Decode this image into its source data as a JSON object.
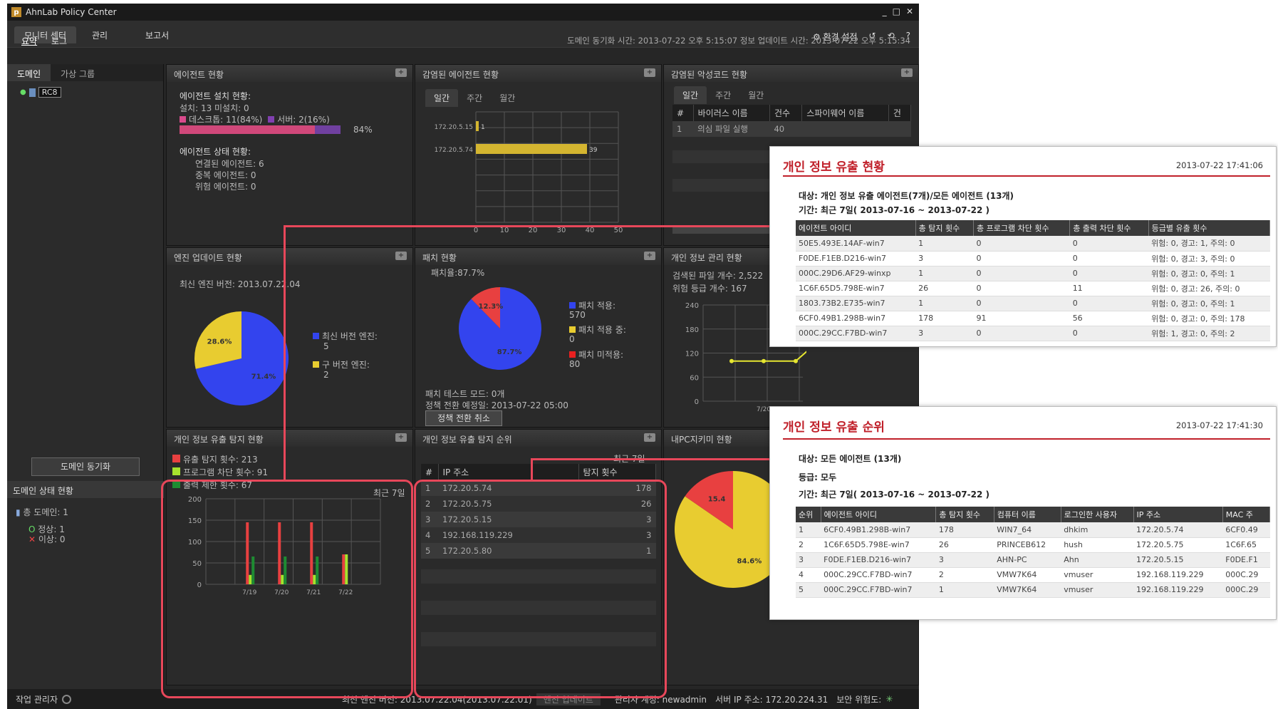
{
  "app": {
    "title": "AhnLab Policy Center",
    "logo_letter": "p",
    "win_controls": [
      "_",
      "□",
      "✕"
    ],
    "menu": [
      "모니터 센터",
      "관리",
      "보고서"
    ],
    "subtabs": [
      "요약",
      "로그"
    ],
    "settings_label": "환경 설정",
    "help_label": "?",
    "sync_time": "도메인 동기화 시간: 2013-07-22 오후 5:15:07   정보 업데이트 시간: 2013-07-22 오후 5:15:34"
  },
  "left": {
    "tabs": [
      "도메인",
      "가상 그룹"
    ],
    "tree_node": "RC8",
    "sync_button": "도메인 동기화",
    "status_title": "도메인 상태 현황",
    "total_domains": "총 도메인: 1",
    "normal": "정상: 1",
    "abnormal": "이상: 0"
  },
  "agent_panel": {
    "title": "에이전트 현황",
    "install_title": "에이전트 설치 현황:",
    "install_counts": "설치: 13   미설치: 0",
    "desktop": "데스크톱: 11(84%)",
    "server": "서버: 2(16%)",
    "install_pct": "84%",
    "install_fraction": 0.84,
    "state_title": "에이전트 상태 현황:",
    "connected": "연결된 에이전트: 6",
    "duplicate": "중복 에이전트: 0",
    "risk": "위험 에이전트: 0"
  },
  "infected_agent_panel": {
    "title": "감염된 에이전트 현황",
    "tabs": [
      "일간",
      "주간",
      "월간"
    ]
  },
  "malware_panel": {
    "title": "감염된 악성코드 현황",
    "tabs": [
      "일간",
      "주간",
      "월간"
    ],
    "columns": [
      "#",
      "바이러스 이름",
      "건수",
      "스파이웨어 이름",
      "건"
    ],
    "row": [
      "1",
      "의심 파일 실행",
      "40"
    ]
  },
  "engine_panel": {
    "title": "엔진 업데이트 현황",
    "latest": "최신 엔진 버전: 2013.07.22.04",
    "legend_latest": "최신 버전 엔진:",
    "legend_latest_count": "5",
    "legend_old": "구 버전 엔진:",
    "legend_old_count": "2",
    "label_new": "71.4%",
    "label_old": "28.6%"
  },
  "patch_panel": {
    "title": "패치 현황",
    "rate": "패치율:87.7%",
    "legend_applied": "패치 적용:",
    "legend_applied_count": "570",
    "legend_applying": "패치 적용 중:",
    "legend_applying_count": "0",
    "legend_unapplied": "패치 미적용:",
    "legend_unapplied_count": "80",
    "label_applied": "87.7%",
    "label_unapplied": "12.3%",
    "test_mode": "패치 테스트 모드: 0개",
    "policy_switch": "정책 전환 예정일: 2013-07-22 05:00",
    "cancel_button": "정책 전환 취소"
  },
  "privacy_mgmt_panel": {
    "title": "개인 정보 관리 현황",
    "files": "검색된 파일 개수: 2,522",
    "risk_level": "위험 등급 개수: 167"
  },
  "leak_detect_panel": {
    "title": "개인 정보 유출 탐지 현황",
    "legend_leak": "유출 탐지 횟수: 213",
    "legend_block": "프로그램 차단 횟수: 91",
    "legend_output": "출력 제한 횟수: 67",
    "period": "최근 7일"
  },
  "leak_rank_panel": {
    "title": "개인 정보 유출 탐지 순위",
    "period": "최근 7일",
    "columns": [
      "#",
      "IP 주소",
      "탐지 횟수"
    ],
    "rows": [
      [
        "1",
        "172.20.5.74",
        "178"
      ],
      [
        "2",
        "172.20.5.75",
        "26"
      ],
      [
        "3",
        "172.20.5.15",
        "3"
      ],
      [
        "4",
        "192.168.119.229",
        "3"
      ],
      [
        "5",
        "172.20.5.80",
        "1"
      ]
    ]
  },
  "mypc_panel": {
    "title": "내PC지키미 현황",
    "label_main": "84.6%",
    "label_small": "15.4"
  },
  "status": {
    "task_manager": "작업 관리자",
    "engine_version": "최신 엔진 버전: 2013.07.22.04(2013.07.22.01)",
    "engine_update_button": "엔진 업데이트",
    "admin": "관리자 계정: newadmin",
    "server_ip": "서버 IP 주소: 172.20.224.31",
    "security": "보안 위험도:"
  },
  "popup1": {
    "title": "개인 정보 유출 현황",
    "date": "2013-07-22 17:41:06",
    "target": "대상: 개인 정보 유출 에이전트(7개)/모든 에이전트 (13개)",
    "period": "기간: 최근 7일( 2013-07-16 ~ 2013-07-22 )",
    "columns": [
      "에이전트 아이디",
      "총 탐지 횟수",
      "총 프로그램 차단 횟수",
      "총 출력 차단 횟수",
      "등급별 유출 횟수"
    ],
    "rows": [
      [
        "50E5.493E.14AF-win7",
        "1",
        "0",
        "0",
        "위험: 0, 경고: 1, 주의: 0"
      ],
      [
        "F0DE.F1EB.D216-win7",
        "3",
        "0",
        "0",
        "위험: 0, 경고: 3, 주의: 0"
      ],
      [
        "000C.29D6.AF29-winxp",
        "1",
        "0",
        "0",
        "위험: 0, 경고: 0, 주의: 1"
      ],
      [
        "1C6F.65D5.798E-win7",
        "26",
        "0",
        "11",
        "위험: 0, 경고: 26, 주의: 0"
      ],
      [
        "1803.73B2.E735-win7",
        "1",
        "0",
        "0",
        "위험: 0, 경고: 0, 주의: 1"
      ],
      [
        "6CF0.49B1.298B-win7",
        "178",
        "91",
        "56",
        "위험: 0, 경고: 0, 주의: 178"
      ],
      [
        "000C.29CC.F7BD-win7",
        "3",
        "0",
        "0",
        "위험: 1, 경고: 0, 주의: 2"
      ]
    ]
  },
  "popup2": {
    "title": "개인 정보 유출 순위",
    "date": "2013-07-22 17:41:30",
    "target": "대상: 모든 에이전트 (13개)",
    "grade": "등급: 모두",
    "period": "기간: 최근 7일( 2013-07-16 ~ 2013-07-22 )",
    "columns": [
      "순위",
      "에이전트 아이디",
      "총 탐지 횟수",
      "컴퓨터 이름",
      "로그인한 사용자",
      "IP 주소",
      "MAC 주"
    ],
    "rows": [
      [
        "1",
        "6CF0.49B1.298B-win7",
        "178",
        "WIN7_64",
        "dhkim",
        "172.20.5.74",
        "6CF0.49"
      ],
      [
        "2",
        "1C6F.65D5.798E-win7",
        "26",
        "PRINCEB612",
        "hush",
        "172.20.5.75",
        "1C6F.65"
      ],
      [
        "3",
        "F0DE.F1EB.D216-win7",
        "3",
        "AHN-PC",
        "Ahn",
        "172.20.5.15",
        "F0DE.F1"
      ],
      [
        "4",
        "000C.29CC.F7BD-win7",
        "2",
        "VMW7K64",
        "vmuser",
        "192.168.119.229",
        "000C.29"
      ],
      [
        "5",
        "000C.29CC.F7BD-win7",
        "1",
        "VMW7K64",
        "vmuser",
        "192.168.119.229",
        "000C.29"
      ]
    ]
  },
  "chart_data": [
    {
      "type": "bar",
      "orientation": "horizontal",
      "title": "감염된 에이전트 현황",
      "categories": [
        "172.20.5.15",
        "172.20.5.74"
      ],
      "values": [
        1,
        39
      ],
      "xlim": [
        0,
        50
      ],
      "xticks": [
        0,
        10,
        20,
        30,
        40,
        50
      ],
      "color": "#d4b530"
    },
    {
      "type": "pie",
      "title": "엔진 업데이트 현황",
      "labels": [
        "최신 버전 엔진",
        "구 버전 엔진"
      ],
      "values": [
        71.4,
        28.6
      ],
      "colors": [
        "#3344ee",
        "#e8cc30"
      ]
    },
    {
      "type": "pie",
      "title": "패치 현황",
      "labels": [
        "패치 적용",
        "패치 적용 중",
        "패치 미적용"
      ],
      "values": [
        87.7,
        0,
        12.3
      ],
      "colors": [
        "#3344ee",
        "#e8cc30",
        "#e84040"
      ]
    },
    {
      "type": "line",
      "title": "개인 정보 관리 현황",
      "ylim": [
        0,
        240
      ],
      "yticks": [
        0,
        60,
        120,
        180,
        240
      ],
      "xticks": [
        "7/20"
      ],
      "values": [
        100,
        100,
        100,
        170
      ],
      "color": "#e6e630"
    },
    {
      "type": "bar",
      "title": "개인 정보 유출 탐지 현황",
      "categories": [
        "7/19",
        "7/20",
        "7/21",
        "7/22"
      ],
      "ylim": [
        0,
        200
      ],
      "yticks": [
        0,
        50,
        100,
        150,
        200
      ],
      "series": [
        {
          "name": "유출 탐지 횟수",
          "color": "#e84040",
          "values": [
            145,
            145,
            145,
            70
          ]
        },
        {
          "name": "프로그램 차단 횟수",
          "color": "#a6e22e",
          "values": [
            22,
            22,
            22,
            70
          ]
        },
        {
          "name": "출력 제한 횟수",
          "color": "#1e8c32",
          "values": [
            65,
            65,
            65,
            0
          ]
        }
      ]
    },
    {
      "type": "pie",
      "title": "내PC지키미 현황",
      "values": [
        84.6,
        15.4
      ],
      "colors": [
        "#e8cc30",
        "#e84040"
      ]
    }
  ]
}
